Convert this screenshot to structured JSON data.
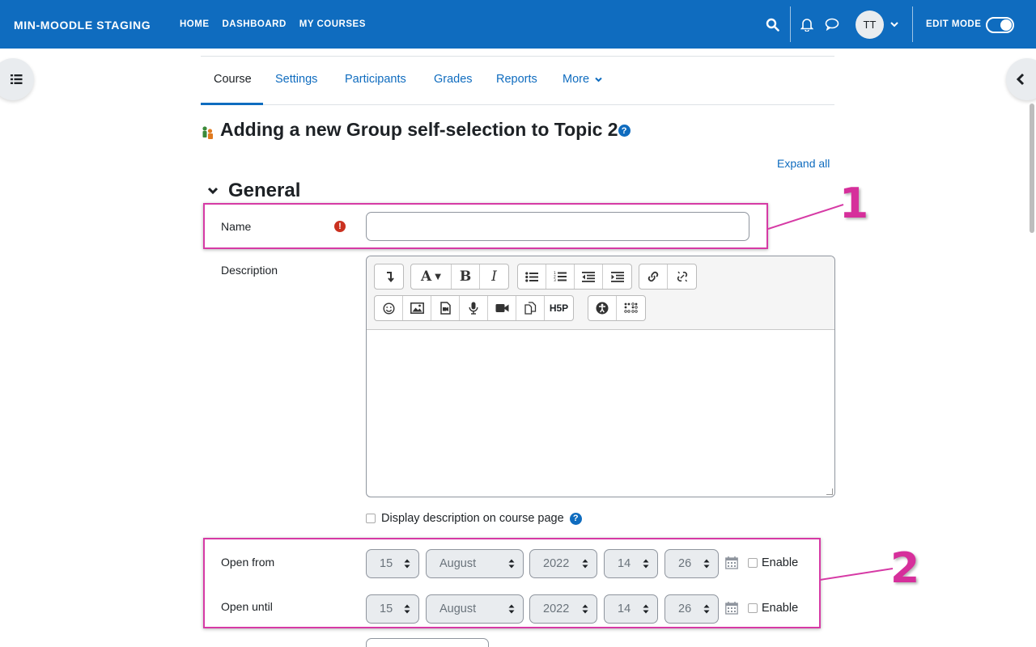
{
  "navbar": {
    "brand": "MIN-MOODLE STAGING",
    "links": [
      "HOME",
      "DASHBOARD",
      "MY COURSES"
    ],
    "avatar_initials": "TT",
    "edit_mode_label": "EDIT MODE",
    "edit_mode_on": true,
    "color": "#0f6cbf"
  },
  "secondary_nav": {
    "tabs": [
      "Course",
      "Settings",
      "Participants",
      "Grades",
      "Reports",
      "More"
    ],
    "active_tab": "Course"
  },
  "page": {
    "title": "Adding a new Group self-selection to Topic 2",
    "help_icon": "?",
    "expand_all": "Expand all"
  },
  "general_section": {
    "heading": "General",
    "name_label": "Name",
    "name_value": "",
    "description_label": "Description",
    "display_description_label": "Display description on course page"
  },
  "editor": {
    "row1_groups": [
      [
        "collapse"
      ],
      [
        "font-style",
        "bold",
        "italic"
      ],
      [
        "unordered-list",
        "ordered-list",
        "outdent",
        "indent"
      ],
      [
        "link",
        "unlink"
      ]
    ],
    "row2_groups": [
      [
        "emoji",
        "image",
        "media",
        "record-audio",
        "record-video",
        "manage-files",
        "h5p"
      ],
      [
        "accessibility-checker",
        "screenreader-helper"
      ]
    ],
    "h5p_label": "H5P",
    "font_label": "A",
    "bold_label": "B",
    "italic_label": "I"
  },
  "dates": {
    "open_from": {
      "label": "Open from",
      "day": "15",
      "month": "August",
      "year": "2022",
      "hour": "14",
      "minute": "26",
      "enable_label": "Enable"
    },
    "open_until": {
      "label": "Open until",
      "day": "15",
      "month": "August",
      "year": "2022",
      "hour": "14",
      "minute": "26",
      "enable_label": "Enable"
    }
  },
  "annotations": {
    "one": "1",
    "two": "2",
    "color": "#d63aa5"
  }
}
